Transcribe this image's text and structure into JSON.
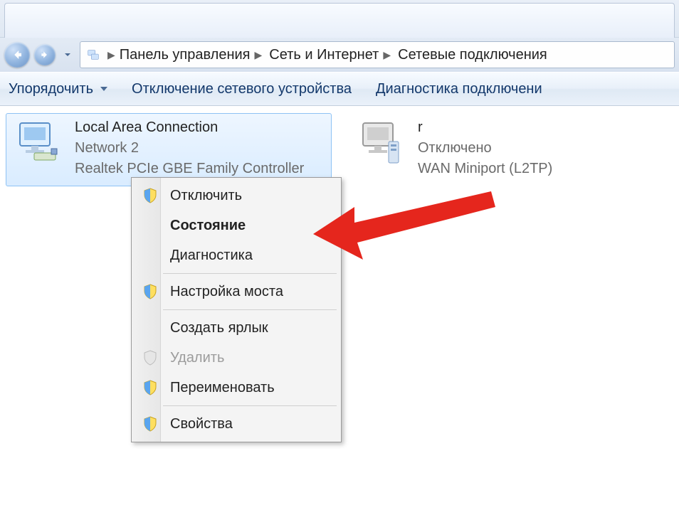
{
  "breadcrumb": {
    "items": [
      "Панель управления",
      "Сеть и Интернет",
      "Сетевые подключения"
    ]
  },
  "toolbar": {
    "organize": "Упорядочить",
    "disable_device": "Отключение сетевого устройства",
    "diagnose": "Диагностика подключени"
  },
  "connections": [
    {
      "name": "Local Area Connection",
      "status": "Network 2",
      "device": "Realtek PCIe GBE Family Controller",
      "selected": true
    },
    {
      "name": "r",
      "status": "Отключено",
      "device": "WAN Miniport (L2TP)",
      "selected": false
    }
  ],
  "context_menu": {
    "items": [
      {
        "label": "Отключить",
        "shield": true,
        "bold": false,
        "disabled": false
      },
      {
        "label": "Состояние",
        "shield": false,
        "bold": true,
        "disabled": false
      },
      {
        "label": "Диагностика",
        "shield": false,
        "bold": false,
        "disabled": false
      },
      {
        "sep": true
      },
      {
        "label": "Настройка моста",
        "shield": true,
        "bold": false,
        "disabled": false
      },
      {
        "sep": true
      },
      {
        "label": "Создать ярлык",
        "shield": false,
        "bold": false,
        "disabled": false
      },
      {
        "label": "Удалить",
        "shield": true,
        "bold": false,
        "disabled": true
      },
      {
        "label": "Переименовать",
        "shield": true,
        "bold": false,
        "disabled": false
      },
      {
        "sep": true
      },
      {
        "label": "Свойства",
        "shield": true,
        "bold": false,
        "disabled": false
      }
    ]
  },
  "annotation": {
    "kind": "arrow",
    "color": "#e5261d"
  }
}
